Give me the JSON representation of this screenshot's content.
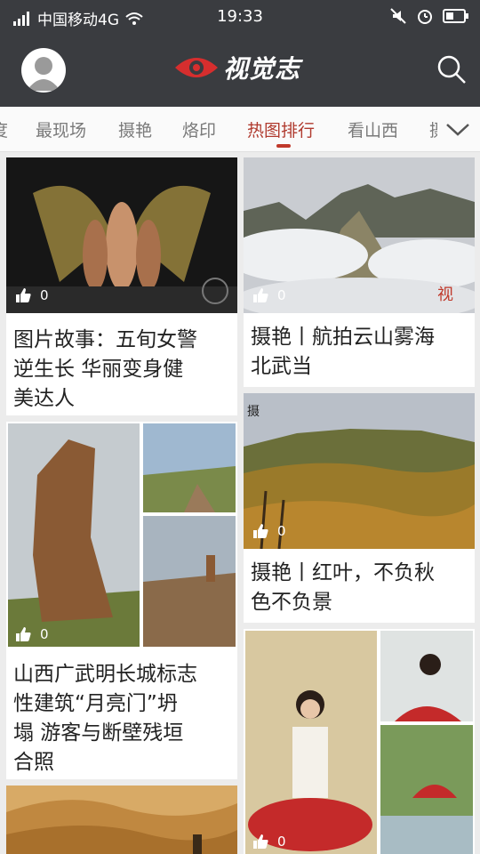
{
  "status": {
    "carrier": "中国移动4G",
    "time": "19:33"
  },
  "header": {
    "logo_text": "视觉志"
  },
  "tabs": [
    {
      "label": "度"
    },
    {
      "label": "最现场"
    },
    {
      "label": "摄艳"
    },
    {
      "label": "烙印"
    },
    {
      "label": "热图排行",
      "active": true
    },
    {
      "label": "看山西"
    },
    {
      "label": "摄"
    }
  ],
  "cards": [
    {
      "likes": "0",
      "title": [
        "图片故事：五旬女警",
        "逆生长 华丽变身健",
        "美达人"
      ]
    },
    {
      "likes": "0",
      "title": [
        "摄艳丨航拍云山雾海",
        "北武当"
      ]
    },
    {
      "likes": "0",
      "title": [
        "摄艳丨红叶，不负秋",
        "色不负景"
      ]
    },
    {
      "likes": "0",
      "title": [
        "山西广武明长城标志",
        "性建筑“月亮门”坍",
        "塌 游客与断壁残垣",
        "合照"
      ]
    },
    {
      "likes": "0"
    }
  ],
  "colors": {
    "bar": "#3a3c40",
    "accent": "#c0392b",
    "background": "#ececec"
  }
}
